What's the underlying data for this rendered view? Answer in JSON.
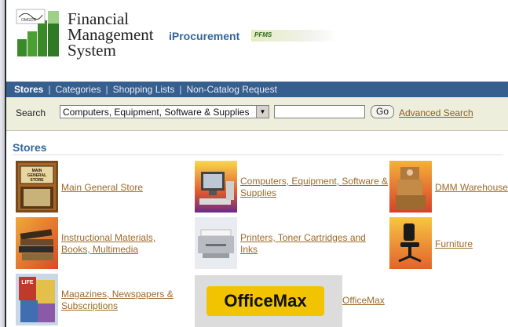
{
  "header": {
    "logo_caption": "OMGDS",
    "title_lines": [
      "Financial",
      "Management",
      "System"
    ],
    "app_name": "iProcurement",
    "badge": "PFMS"
  },
  "nav": {
    "tabs": [
      "Stores",
      "Categories",
      "Shopping Lists",
      "Non-Catalog Request"
    ],
    "separator": "|"
  },
  "search": {
    "label": "Search",
    "selected_store": "Computers, Equipment, Software & Supplies",
    "query": "",
    "go_label": "Go",
    "advanced_label": "Advanced Search"
  },
  "stores_heading": "Stores",
  "stores": [
    {
      "name": "Main General Store",
      "sign_text": "MAIN GENERAL STORE"
    },
    {
      "name": "Computers, Equipment, Software & Supplies"
    },
    {
      "name": "DMM Warehouse"
    },
    {
      "name": "Instructional Materials, Books, Multimedia"
    },
    {
      "name": "Printers, Toner Cartridges and Inks"
    },
    {
      "name": "Furniture"
    },
    {
      "name": "Magazines, Newspapers & Subscriptions",
      "thumb_text": "LIFE"
    },
    {
      "name": "OfficeMax",
      "logo_text": "OfficeMax"
    }
  ],
  "colors": {
    "nav_bg": "#365e8e",
    "accent": "#336699",
    "link": "#9c6a2a",
    "search_band": "#eeeedd",
    "officemax_yellow": "#f2c300"
  }
}
